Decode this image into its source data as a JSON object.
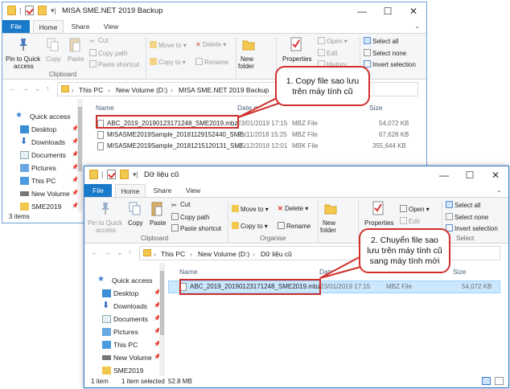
{
  "window1": {
    "title": "MISA SME.NET 2019 Backup",
    "tabs": [
      "File",
      "Home",
      "Share",
      "View"
    ],
    "ribbon": {
      "pin_label_1": "Pin to Quick",
      "pin_label_2": "access",
      "copy": "Copy",
      "paste": "Paste",
      "cut": "Cut",
      "copy_path": "Copy path",
      "paste_shortcut": "Paste shortcut",
      "move_to": "Move to",
      "copy_to": "Copy to",
      "delete": "Delete",
      "rename": "Rename",
      "new_1": "New",
      "new_2": "folder",
      "properties": "Properties",
      "open": "Open",
      "edit": "Edit",
      "history": "History",
      "select_all": "Select all",
      "select_none": "Select none",
      "invert_selection": "Invert selection",
      "group_clipboard": "Clipboard"
    },
    "address": [
      "This PC",
      "New Volume (D:)",
      "MISA SME.NET 2019 Backup"
    ],
    "nav": {
      "quick_access": "Quick access",
      "items": [
        "Desktop",
        "Downloads",
        "Documents",
        "Pictures",
        "This PC",
        "New Volume",
        "SME2019"
      ]
    },
    "columns": {
      "name": "Name",
      "date": "Date m",
      "size": "Size"
    },
    "files": [
      {
        "name": "ABC_2019_20190123171248_SME2019.mbz",
        "date": "23/01/2019 17:15",
        "type": "MBZ File",
        "size": "54,072 KB"
      },
      {
        "name": "MISASME2019Sample_20181129152440_SME...",
        "date": "29/11/2018 15:25",
        "type": "MBZ File",
        "size": "67,628 KB"
      },
      {
        "name": "MISASME2019Sample_20181215120131_SME...",
        "date": "15/12/2018 12:01",
        "type": "MBK File",
        "size": "355,644 KB"
      }
    ],
    "status": {
      "count": "3 items"
    }
  },
  "window2": {
    "title": "Dữ liệu cũ",
    "tabs": [
      "File",
      "Home",
      "Share",
      "View"
    ],
    "ribbon": {
      "pin_label_1": "Pin to Quick",
      "pin_label_2": "access",
      "copy": "Copy",
      "paste": "Paste",
      "cut": "Cut",
      "copy_path": "Copy path",
      "paste_shortcut": "Paste shortcut",
      "move_to": "Move to",
      "copy_to": "Copy to",
      "delete": "Delete",
      "rename": "Rename",
      "new_1": "New",
      "new_2": "folder",
      "properties": "Properties",
      "open": "Open",
      "edit": "Edit",
      "select_all": "Select all",
      "select_none": "Select none",
      "invert_selection": "Invert selection",
      "group_clipboard": "Clipboard",
      "group_organise": "Organise",
      "group_select": "Select"
    },
    "address": [
      "This PC",
      "New Volume (D:)",
      "Dữ liệu cũ"
    ],
    "nav": {
      "quick_access": "Quick access",
      "items": [
        "Desktop",
        "Downloads",
        "Documents",
        "Pictures",
        "This PC",
        "New Volume",
        "SME2019"
      ]
    },
    "columns": {
      "name": "Name",
      "date": "Date",
      "size": "Size"
    },
    "files": [
      {
        "name": "ABC_2019_20190123171248_SME2019.mbz",
        "date": "23/01/2019 17:15",
        "type": "MBZ File",
        "size": "54,072 KB"
      }
    ],
    "status": {
      "count": "1 item",
      "selected": "1 item selected",
      "size": "52.8 MB"
    }
  },
  "callouts": {
    "step1_line1": "1. Copy file sao lưu",
    "step1_line2": "trên máy tính cũ",
    "step2_line1": "2. Chuyển file sao",
    "step2_line2": "lưu trên máy tính cũ",
    "step2_line3": "sang máy tính mới"
  },
  "colors": {
    "accent": "#1979ca",
    "highlight": "#d0302c",
    "selection": "#cce8ff"
  }
}
